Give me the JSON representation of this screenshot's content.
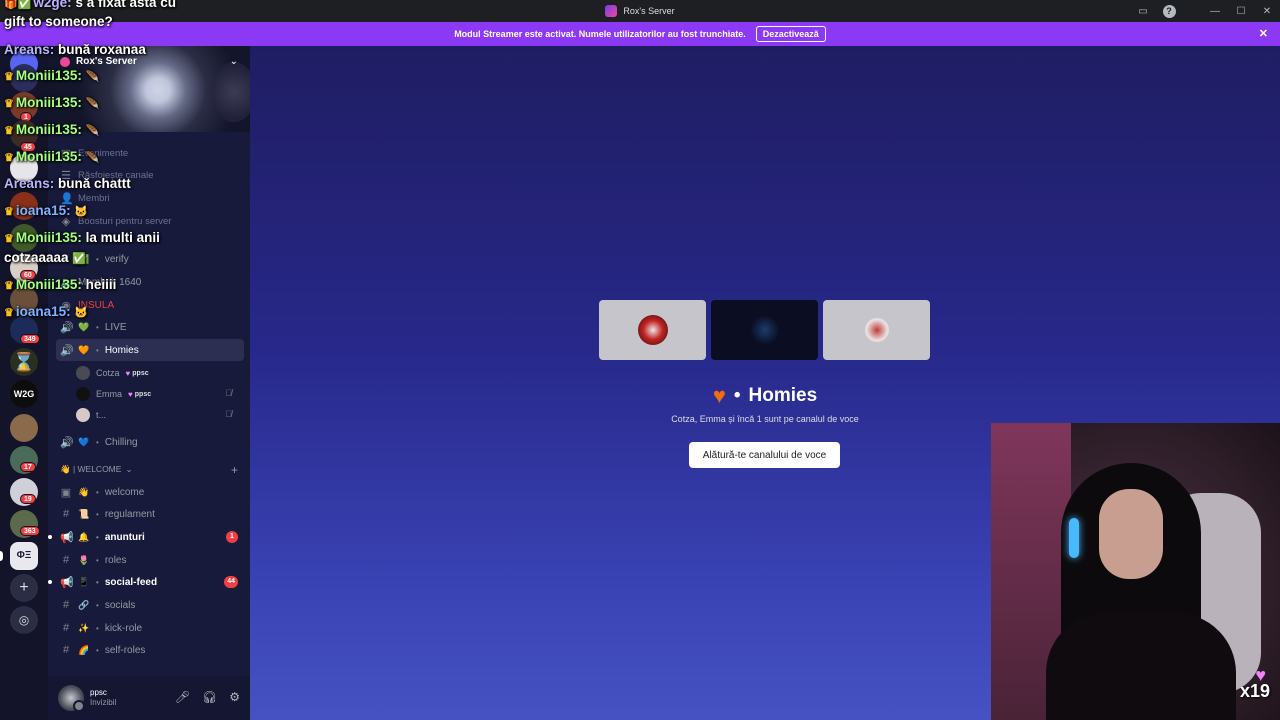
{
  "titlebar": {
    "title": "Rox's Server"
  },
  "banner": {
    "message": "Modul Streamer este activat. Numele utilizatorilor au fost trunchiate.",
    "button": "Dezactivează"
  },
  "server": {
    "name": "Rox's Server"
  },
  "guild_badges": [
    "1",
    "45",
    "60",
    "349",
    "17",
    "19",
    "363"
  ],
  "sidebar": {
    "menu": [
      "Evenimente",
      "Răsfoiește canale",
      "Membri",
      "Boosturi pentru server"
    ],
    "verify": "verify",
    "members_count": "Membrii: 1640",
    "insula": "INSULA",
    "voice": [
      {
        "name": "LIVE",
        "emoji": "💚"
      },
      {
        "name": "Homies",
        "emoji": "🧡"
      },
      {
        "name": "Chilling",
        "emoji": "💙"
      }
    ],
    "homies_users": [
      {
        "name": "Cotza",
        "tag": "ppsc"
      },
      {
        "name": "Emma",
        "tag": "ppsc"
      },
      {
        "name": "t...",
        "tag": ""
      }
    ],
    "category": "👋 | WELCOME",
    "channels": [
      {
        "name": "welcome",
        "emoji": "👋",
        "badge": ""
      },
      {
        "name": "regulament",
        "emoji": "📜",
        "badge": ""
      },
      {
        "name": "anunturi",
        "emoji": "🔔",
        "badge": "1"
      },
      {
        "name": "roles",
        "emoji": "🌷",
        "badge": ""
      },
      {
        "name": "social-feed",
        "emoji": "📱",
        "badge": "44"
      },
      {
        "name": "socials",
        "emoji": "🔗",
        "badge": ""
      },
      {
        "name": "kick-role",
        "emoji": "✨",
        "badge": ""
      },
      {
        "name": "self-roles",
        "emoji": "🌈",
        "badge": ""
      }
    ],
    "user": {
      "name": "ppsc",
      "status": "Invizibil"
    }
  },
  "voice_view": {
    "channel": "Homies",
    "subtitle": "Cotza, Emma și încă 1 sunt pe canalul de voce",
    "join_button": "Alătură-te canalului de voce"
  },
  "overlay": {
    "x_count": "x19"
  },
  "chat": [
    {
      "user": "w2ge:",
      "text": "s a fixat asta cu"
    },
    {
      "user": "",
      "text": "gift to someone?"
    },
    {
      "user": "Areans:",
      "text": "bună roxanaa"
    },
    {
      "user": "Moniii135:",
      "text": ""
    },
    {
      "user": "Moniii135:",
      "text": ""
    },
    {
      "user": "Moniii135:",
      "text": ""
    },
    {
      "user": "Moniii135:",
      "text": ""
    },
    {
      "user": "Areans:",
      "text": "bună chattt"
    },
    {
      "user": "ioana15:",
      "text": ""
    },
    {
      "user": "Moniii135:",
      "text": "la multi anii"
    },
    {
      "user": "",
      "text": "cotzaaaaa"
    },
    {
      "user": "Moniii135:",
      "text": "heiiii"
    },
    {
      "user": "ioana15:",
      "text": ""
    }
  ]
}
